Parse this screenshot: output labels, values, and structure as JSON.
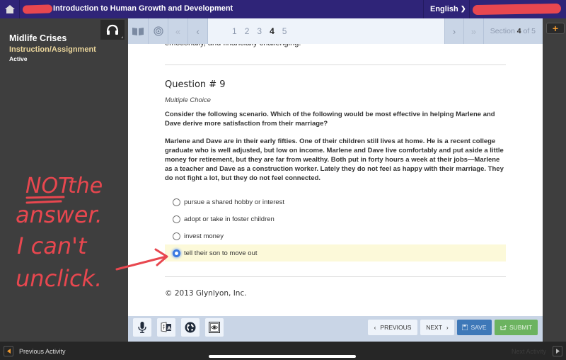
{
  "topbar": {
    "course_title": "Introduction to Human Growth and Development",
    "language": "English"
  },
  "activity": {
    "title": "Midlife Crises",
    "type": "Instruction/Assignment",
    "status": "Active"
  },
  "pager": {
    "pages": [
      "1",
      "2",
      "3",
      "4",
      "5"
    ],
    "current_page": "4",
    "section_prefix": "Section ",
    "section_current": "4",
    "section_suffix": " of 5"
  },
  "content": {
    "previous_text_fragment": "emotionally, and financially challenging.",
    "question_title": "Question # 9",
    "question_type": "Multiple Choice",
    "prompt": "Consider the following scenario. Which of the following would be most effective in helping Marlene and Dave derive more satisfaction from their marriage?",
    "scenario": "Marlene and Dave are in their early fifties. One of their children still lives at home. He is a recent college graduate who is well adjusted, but low on income. Marlene and Dave live comfortably and put aside a little money for retirement, but they are far from wealthy. Both put in forty hours a week at their jobs—Marlene as a teacher and Dave as a construction worker. Lately they do not feel as happy with their marriage. They do not fight a lot, but they do not feel connected.",
    "choices": [
      {
        "label": "pursue a shared hobby or interest",
        "selected": false
      },
      {
        "label": "adopt or take in foster children",
        "selected": false
      },
      {
        "label": "invest money",
        "selected": false
      },
      {
        "label": "tell their son to move out",
        "selected": true
      }
    ],
    "copyright": "© 2013 Glynlyon, Inc."
  },
  "bottom_toolbar": {
    "tools": [
      "microphone-icon",
      "translate-icon",
      "globe-icon",
      "eye-icon"
    ],
    "previous_label": "PREVIOUS",
    "next_label": "NEXT",
    "save_label": "SAVE",
    "submit_label": "SUBMIT"
  },
  "footer": {
    "previous_activity": "Previous Activity",
    "next_activity": "Next Activity"
  },
  "annotation": {
    "line1_underlined": "NOT",
    "line1_rest": "the",
    "line2": "answer.",
    "line3": "I can't",
    "line4": "unclick.",
    "color": "#e8474f"
  },
  "colors": {
    "topbar": "#2f2478",
    "toolbar": "#c9d5e6",
    "save": "#3e78b8",
    "submit": "#6cb360",
    "selected_row": "#fcf9d9",
    "radio_selected": "#3b7ae0",
    "activity_type": "#e9d49a"
  }
}
